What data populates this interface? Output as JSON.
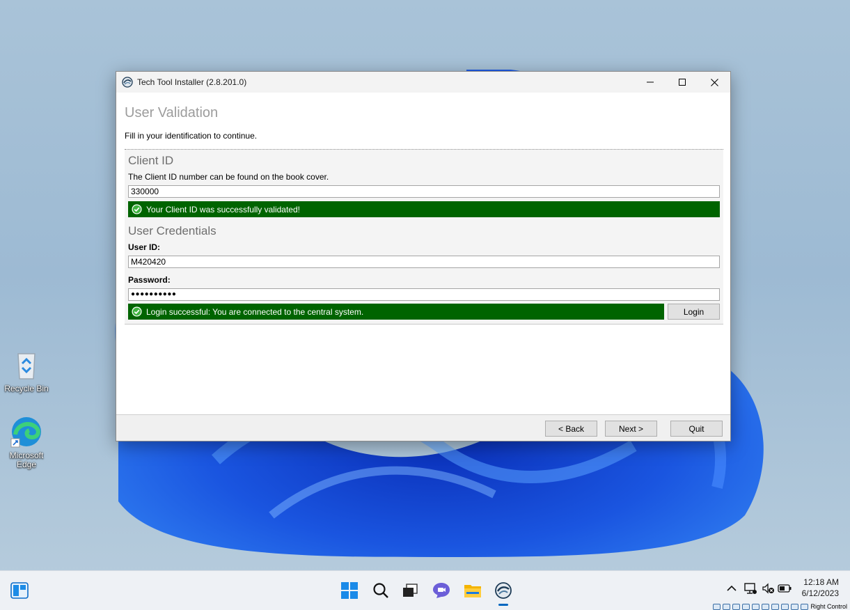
{
  "desktop": {
    "icons": [
      {
        "label": "Recycle Bin"
      },
      {
        "label": "Microsoft Edge"
      }
    ]
  },
  "window": {
    "title": "Tech Tool Installer (2.8.201.0)",
    "page_title": "User Validation",
    "page_subtitle": "Fill in your identification to continue.",
    "client": {
      "heading": "Client ID",
      "description": "The Client ID number can be found on the book cover.",
      "value": "330000",
      "status": "Your Client ID was successfully validated!"
    },
    "credentials": {
      "heading": "User Credentials",
      "user_label": "User ID:",
      "user_value": "M420420",
      "password_label": "Password:",
      "password_value": "●●●●●●●●●●",
      "status": "Login successful: You are connected to the central system.",
      "login_label": "Login"
    },
    "footer": {
      "back_label": "< Back",
      "next_label": "Next >",
      "quit_label": "Quit"
    },
    "colors": {
      "success": "#006400",
      "title_gray": "#9c9c9c"
    }
  },
  "taskbar": {
    "time": "12:18 AM",
    "date": "6/12/2023",
    "host_key": "Right Control"
  }
}
